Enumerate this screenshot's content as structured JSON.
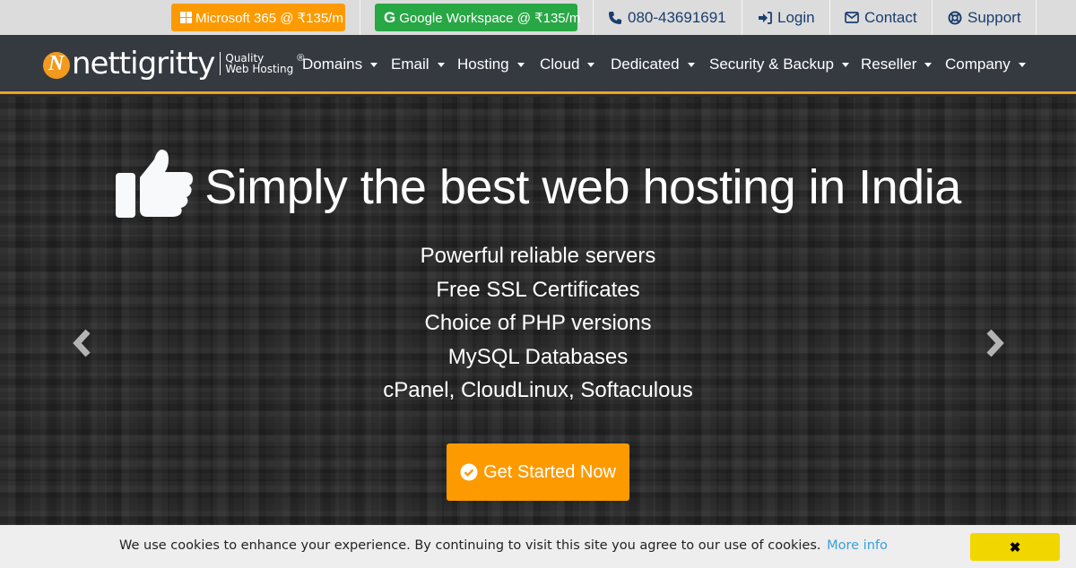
{
  "topbar": {
    "microsoft_365": "Microsoft 365 @ ₹135/m",
    "google_workspace": "Google Workspace @ ₹135/m",
    "phone": "080-43691691",
    "login": "Login",
    "contact": "Contact",
    "support": "Support",
    "icons": {
      "ms": "windows-icon",
      "google": "google-icon",
      "phone": "phone-icon",
      "login": "sign-in-icon",
      "contact": "envelope-icon",
      "support": "life-ring-icon"
    },
    "colors": {
      "ms_bg": "#fd9a00",
      "google_bg": "#28a745",
      "link": "#1a3e6e"
    }
  },
  "navbar": {
    "logo": {
      "glyph": "N",
      "name": "nettigritty",
      "tag_line1": "Quality",
      "tag_line2": "Web Hosting",
      "reg": "®"
    },
    "items": [
      {
        "label": "Domains"
      },
      {
        "label": "Email"
      },
      {
        "label": "Hosting"
      },
      {
        "label": "Cloud"
      },
      {
        "label": "Dedicated"
      },
      {
        "label": "Security & Backup"
      },
      {
        "label": "Reseller"
      },
      {
        "label": "Company"
      }
    ],
    "accent": "#f0a020"
  },
  "hero": {
    "title_icon": "thumbs-up-icon",
    "title": "Simply the best web hosting in India",
    "features": [
      "Powerful reliable servers",
      "Free SSL Certificates",
      "Choice of PHP versions",
      "MySQL Databases",
      "cPanel, CloudLinux, Softaculous"
    ],
    "cta": "Get Started Now",
    "cta_icon": "check-circle-icon",
    "prev_icon": "chevron-left-icon",
    "next_icon": "chevron-right-icon"
  },
  "cookie": {
    "message": "We use cookies to enhance your experience. By continuing to visit this site you agree to our use of cookies.",
    "link": "More info",
    "close": "✖"
  }
}
